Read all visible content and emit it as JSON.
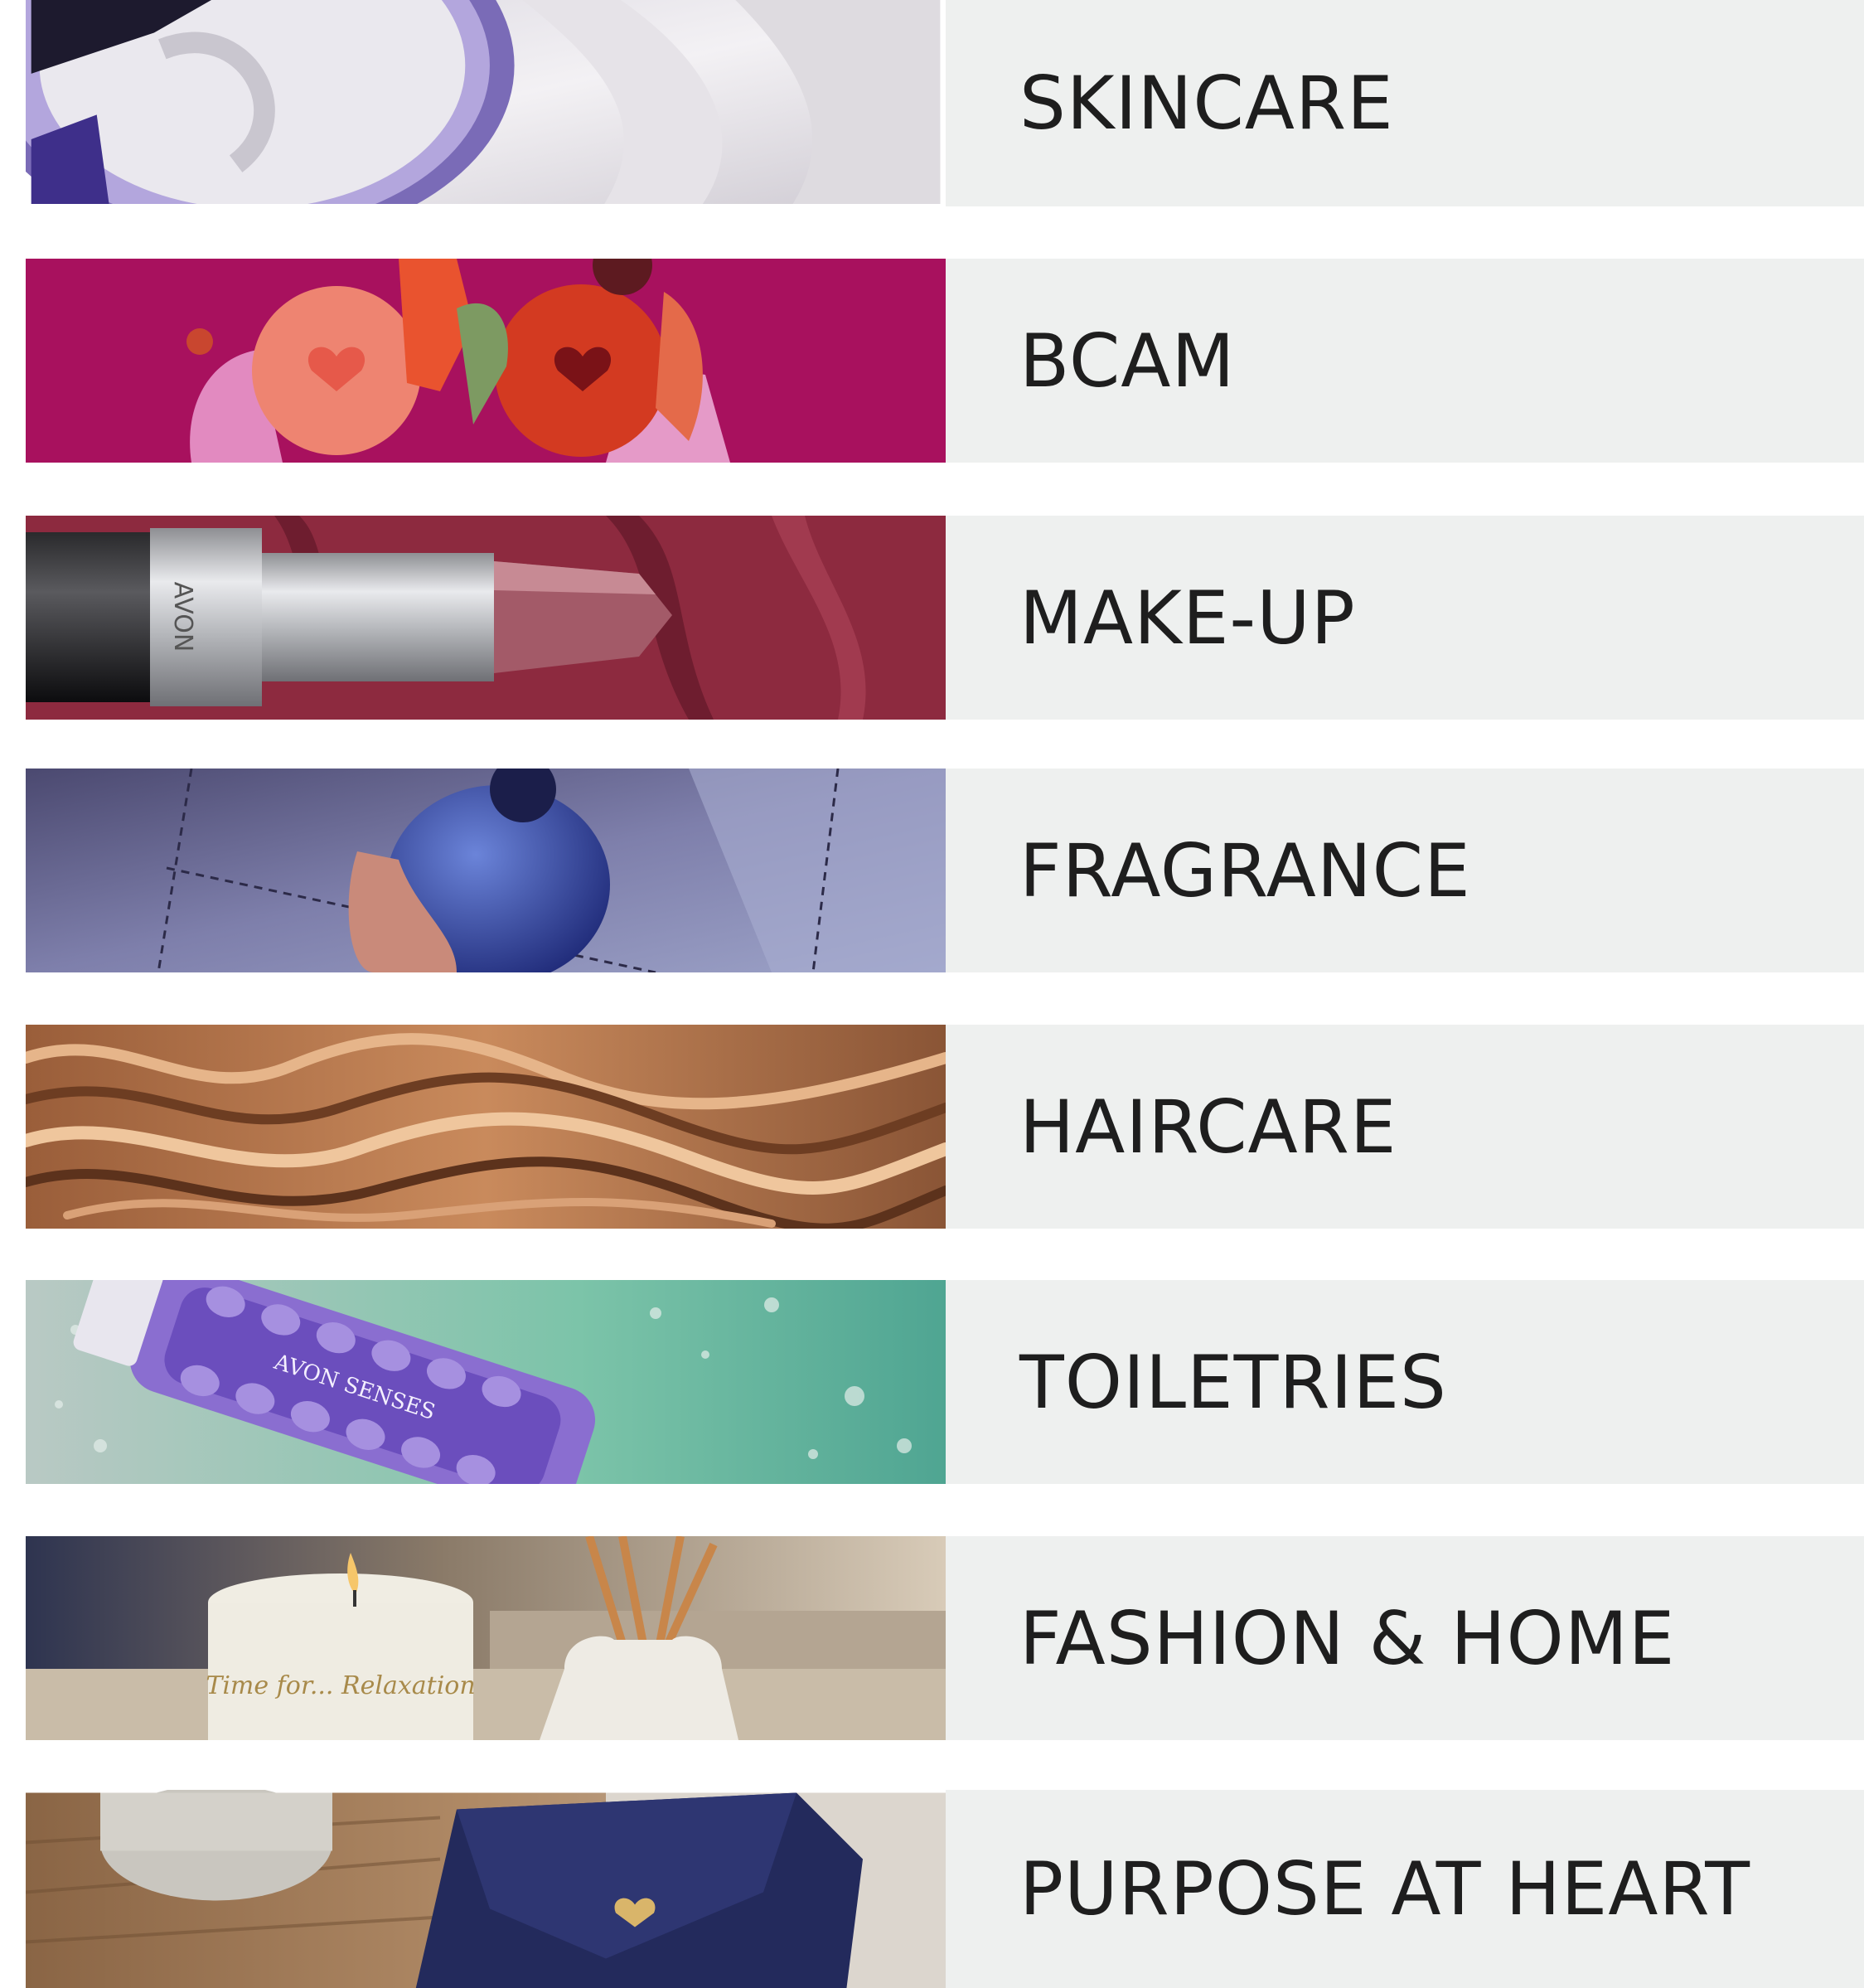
{
  "categories": [
    {
      "id": "skincare",
      "label": "SKINCARE",
      "image": "skincare-cream-jar-image"
    },
    {
      "id": "bcam",
      "label": "BCAM",
      "image": "bcam-illustration-image"
    },
    {
      "id": "makeup",
      "label": "MAKE-UP",
      "image": "lipstick-image"
    },
    {
      "id": "fragrance",
      "label": "FRAGRANCE",
      "image": "perfume-bottle-image"
    },
    {
      "id": "haircare",
      "label": "HAIRCARE",
      "image": "wavy-hair-image"
    },
    {
      "id": "toiletries",
      "label": "TOILETRIES",
      "image": "shower-gel-bottle-image"
    },
    {
      "id": "fashion_home",
      "label": "FASHION & HOME",
      "image": "candle-diffuser-image"
    },
    {
      "id": "purpose",
      "label": "PURPOSE AT HEART",
      "image": "wallet-heart-image"
    }
  ],
  "image_text": {
    "makeup_brand": "AVON",
    "toiletries_brand": "AVON SENSES",
    "candle_script": "Time for... Relaxation"
  },
  "colors": {
    "label_panel": "#eef0ef",
    "label_text": "#1e1e1e",
    "bcam_magenta": "#a8115e"
  }
}
